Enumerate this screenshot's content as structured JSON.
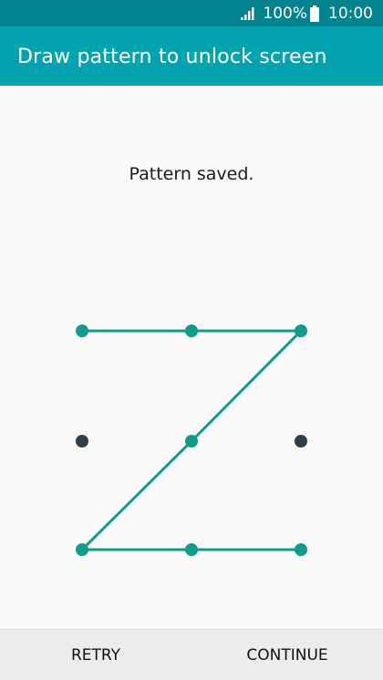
{
  "status_bar": {
    "battery_text": "100%",
    "time": "10:00",
    "icons": [
      "signal-icon",
      "battery-icon"
    ]
  },
  "app_bar": {
    "title": "Draw pattern to unlock screen"
  },
  "message": "Pattern saved.",
  "pattern": {
    "grid": [
      [
        1,
        2,
        3
      ],
      [
        4,
        5,
        6
      ],
      [
        7,
        8,
        9
      ]
    ],
    "sequence": [
      1,
      2,
      3,
      5,
      7,
      8,
      9
    ],
    "active_color": "#139a8a",
    "inactive_color": "#2f3f48"
  },
  "buttons": {
    "retry": "RETRY",
    "continue": "CONTINUE"
  },
  "colors": {
    "status_bar": "#03828f",
    "app_bar": "#04a3b0",
    "background": "#fafafa",
    "bottom_bar": "#ececec"
  }
}
